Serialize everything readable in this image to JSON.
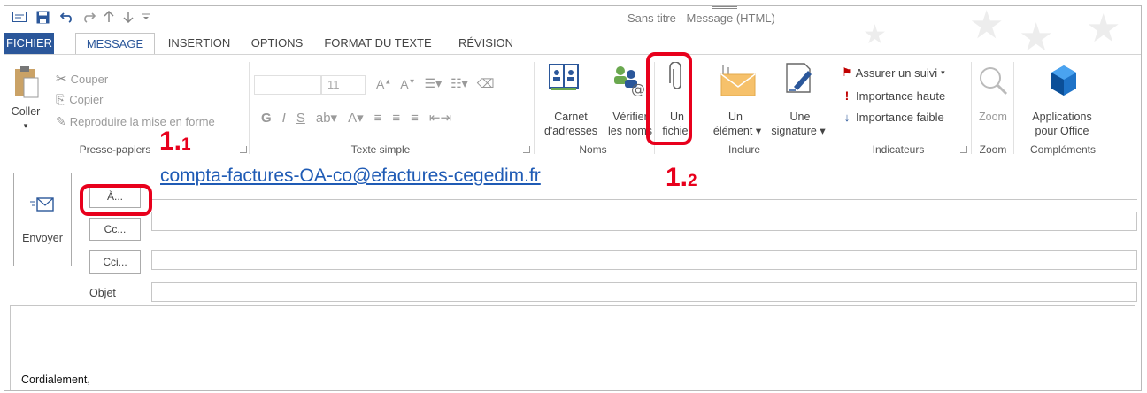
{
  "window": {
    "title": "Sans titre - Message (HTML)"
  },
  "tabs": [
    "FICHIER",
    "MESSAGE",
    "INSERTION",
    "OPTIONS",
    "FORMAT DU TEXTE",
    "RÉVISION"
  ],
  "ribbon": {
    "clipboard": {
      "paste": "Coller",
      "cut": "Couper",
      "copy": "Copier",
      "format_painter": "Reproduire la mise en forme",
      "group": "Presse-papiers"
    },
    "basic_text": {
      "font_size": "11",
      "bold": "G",
      "italic": "I",
      "underline": "S",
      "group": "Texte simple"
    },
    "names": {
      "address_book_line1": "Carnet",
      "address_book_line2": "d'adresses",
      "check_names_line1": "Vérifier",
      "check_names_line2": "les noms",
      "group": "Noms"
    },
    "include": {
      "attach_file_line1": "Un",
      "attach_file_line2": "fichier",
      "attach_item_line1": "Un",
      "attach_item_line2": "élément",
      "signature_line1": "Une",
      "signature_line2": "signature",
      "group": "Inclure"
    },
    "tags": {
      "follow_up": "Assurer un suivi",
      "high_importance": "Importance haute",
      "low_importance": "Importance faible",
      "group": "Indicateurs"
    },
    "zoom": {
      "zoom": "Zoom",
      "group": "Zoom"
    },
    "addins": {
      "apps_line1": "Applications",
      "apps_line2": "pour Office",
      "group": "Compléments"
    }
  },
  "compose": {
    "send": "Envoyer",
    "to_button": "À...",
    "cc_button": "Cc...",
    "bcc_button": "Cci...",
    "subject_label": "Objet",
    "to_value": "compta-factures-OA-co@efactures-cegedim.fr",
    "body": "Cordialement,"
  },
  "annotations": {
    "step1_main": "1.",
    "step1_sub": "1",
    "step2_main": "1.",
    "step2_sub": "2"
  },
  "colors": {
    "accent": "#2b579a",
    "highlight": "#e8001c",
    "link": "#1f5bb5"
  }
}
